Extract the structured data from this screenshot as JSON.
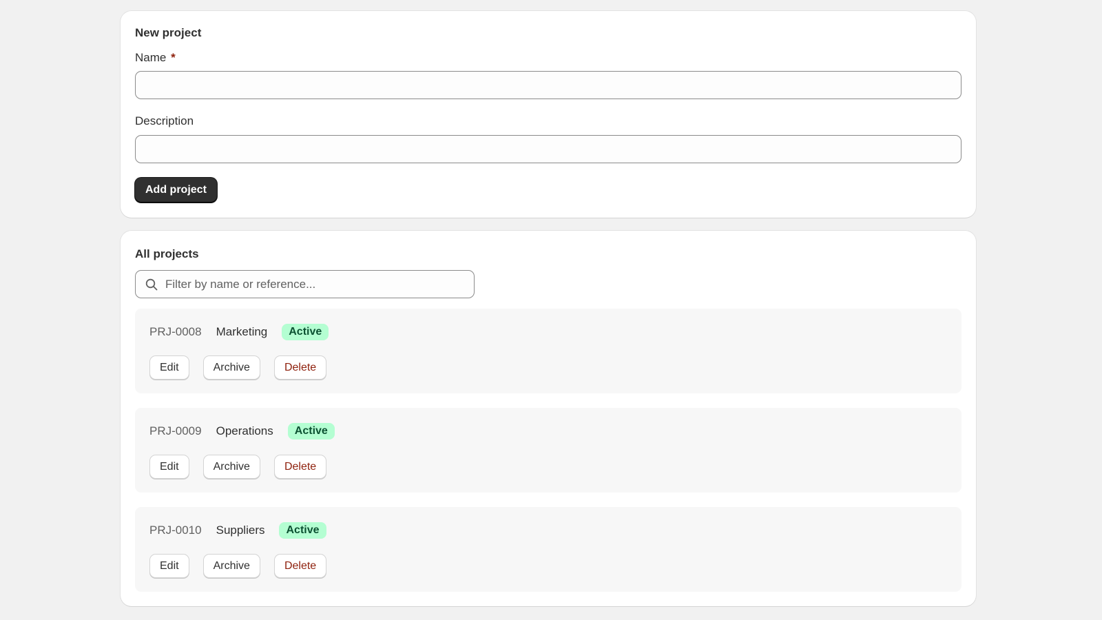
{
  "new_project": {
    "title": "New project",
    "name_label": "Name",
    "required_mark": "*",
    "name_value": "",
    "description_label": "Description",
    "description_value": "",
    "submit_label": "Add project"
  },
  "all_projects": {
    "title": "All projects",
    "search": {
      "placeholder": "Filter by name or reference...",
      "value": "",
      "icon": "search-icon"
    },
    "projects": [
      {
        "ref": "PRJ-0008",
        "name": "Marketing",
        "status": "Active",
        "actions": {
          "edit": "Edit",
          "archive": "Archive",
          "delete": "Delete"
        }
      },
      {
        "ref": "PRJ-0009",
        "name": "Operations",
        "status": "Active",
        "actions": {
          "edit": "Edit",
          "archive": "Archive",
          "delete": "Delete"
        }
      },
      {
        "ref": "PRJ-0010",
        "name": "Suppliers",
        "status": "Active",
        "actions": {
          "edit": "Edit",
          "archive": "Archive",
          "delete": "Delete"
        }
      }
    ]
  },
  "colors": {
    "page_background": "#f1f1f1",
    "card_background": "#ffffff",
    "primary_button": "#303030",
    "required_mark": "#8e1f0b",
    "delete_text": "#8e1f0b",
    "active_badge_background": "#b4fed2",
    "active_badge_text": "#0c5132",
    "row_background": "#f7f7f7"
  }
}
